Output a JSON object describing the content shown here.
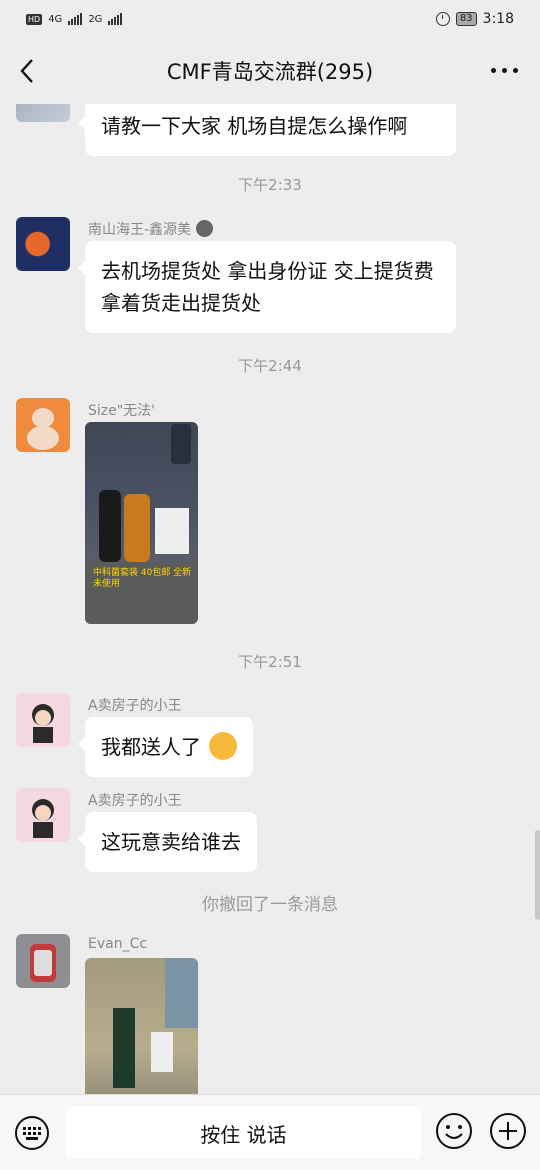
{
  "status_bar": {
    "hd_tag": "HD",
    "net1": "4G",
    "net2": "2G",
    "battery": "83",
    "time": "3:18"
  },
  "nav": {
    "title": "CMF青岛交流群(295)"
  },
  "messages": [
    {
      "type": "text",
      "sender": "",
      "text": "请教一下大家 机场自提怎么操作啊"
    },
    {
      "type": "time",
      "text": "下午2:33"
    },
    {
      "type": "text",
      "sender": "南山海王-鑫源美",
      "text": "去机场提货处 拿出身份证 交上提货费 拿着货走出提货处"
    },
    {
      "type": "time",
      "text": "下午2:44"
    },
    {
      "type": "image",
      "sender": "Size\"无法'",
      "caption": "中科菌套装 40包邮 全新未使用"
    },
    {
      "type": "time",
      "text": "下午2:51"
    },
    {
      "type": "text",
      "sender": "A卖房子的小王",
      "text": "我都送人了"
    },
    {
      "type": "text",
      "sender": "A卖房子的小王",
      "text": "这玩意卖给谁去"
    },
    {
      "type": "system",
      "text": "你撤回了一条消息"
    },
    {
      "type": "image",
      "sender": "Evan_Cc",
      "caption": ""
    }
  ],
  "input_bar": {
    "voice_label": "按住 说话"
  },
  "icons": {
    "back": "chevron-left-icon",
    "more": "more-dots-icon",
    "keyboard": "keyboard-icon",
    "emoji": "emoji-icon",
    "plus": "plus-icon"
  },
  "colors": {
    "background": "#ededed",
    "bubble": "#ffffff",
    "timestamp": "#999999"
  }
}
